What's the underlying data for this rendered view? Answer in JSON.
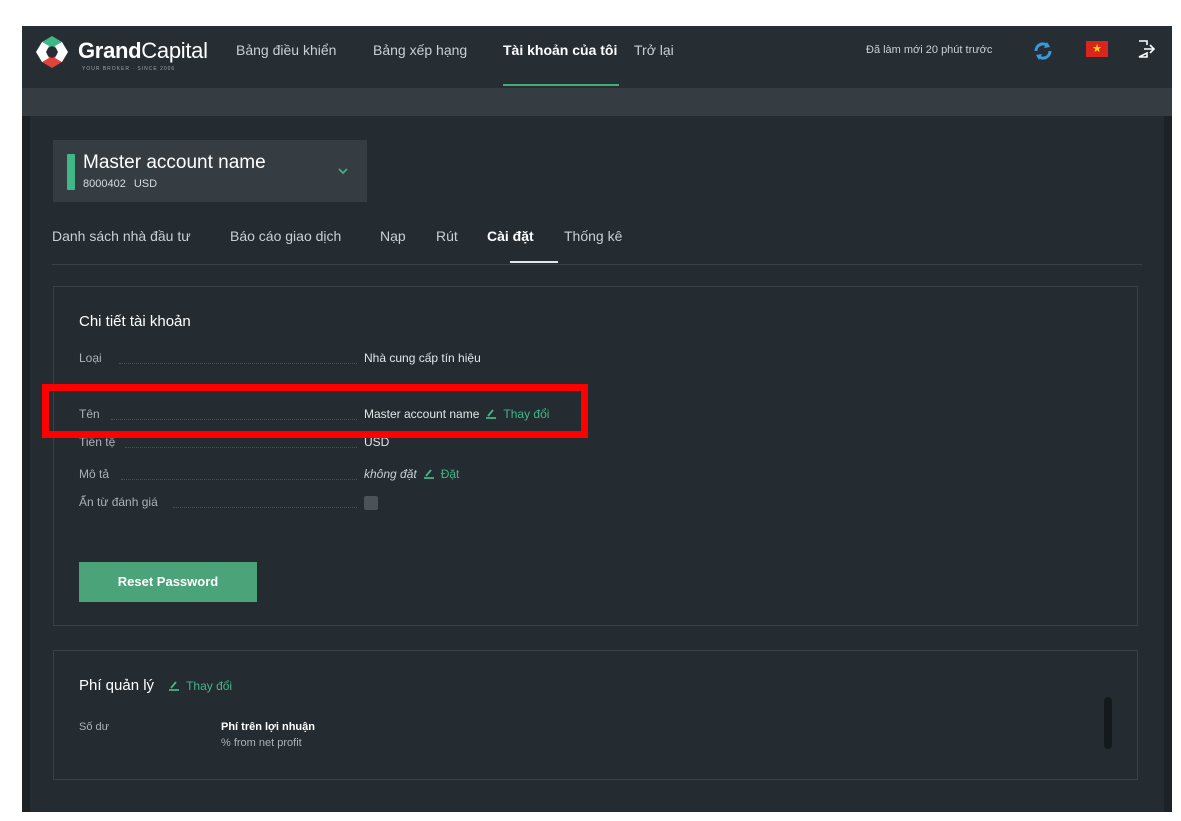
{
  "brand": {
    "name_bold": "Grand",
    "name_light": "Capital",
    "tagline": "YOUR BROKER · SINCE 2006"
  },
  "nav": {
    "items": [
      {
        "label": "Bảng điều khiển"
      },
      {
        "label": "Bảng xếp hạng"
      },
      {
        "label": "Tài khoản của tôi",
        "active": true
      },
      {
        "label": "Trở lại"
      }
    ],
    "refresh_text": "Đã làm mới 20 phút trước",
    "icons": {
      "refresh": "refresh-icon",
      "flag": "vietnam-flag-icon",
      "logout": "logout-icon"
    }
  },
  "account": {
    "name": "Master account name",
    "number": "8000402",
    "currency": "USD"
  },
  "tabs": [
    {
      "label": "Danh sách nhà đầu tư"
    },
    {
      "label": "Báo cáo giao dịch"
    },
    {
      "label": "Nạp"
    },
    {
      "label": "Rút"
    },
    {
      "label": "Cài đặt",
      "active": true
    },
    {
      "label": "Thống kê"
    }
  ],
  "details": {
    "title": "Chi tiết tài khoản",
    "rows": [
      {
        "label": "Loại",
        "value": "Nhà cung cấp tín hiệu"
      },
      {
        "label": "Tên",
        "value": "Master account name",
        "action": "Thay đổi"
      },
      {
        "label": "Tiền tệ",
        "value": "USD"
      },
      {
        "label": "Mô tả",
        "value": "không đặt",
        "action": "Đặt"
      },
      {
        "label": "Ẩn từ đánh giá",
        "checked": false
      }
    ],
    "reset_label": "Reset Password"
  },
  "fees": {
    "title": "Phí quản lý",
    "action": "Thay đổi",
    "col1": "Số dư",
    "col2_title": "Phí trên lợi nhuận",
    "col2_sub": "% from net profit"
  },
  "colors": {
    "accent": "#3fb787",
    "highlight": "#ff0000",
    "background": "#1c2226"
  }
}
